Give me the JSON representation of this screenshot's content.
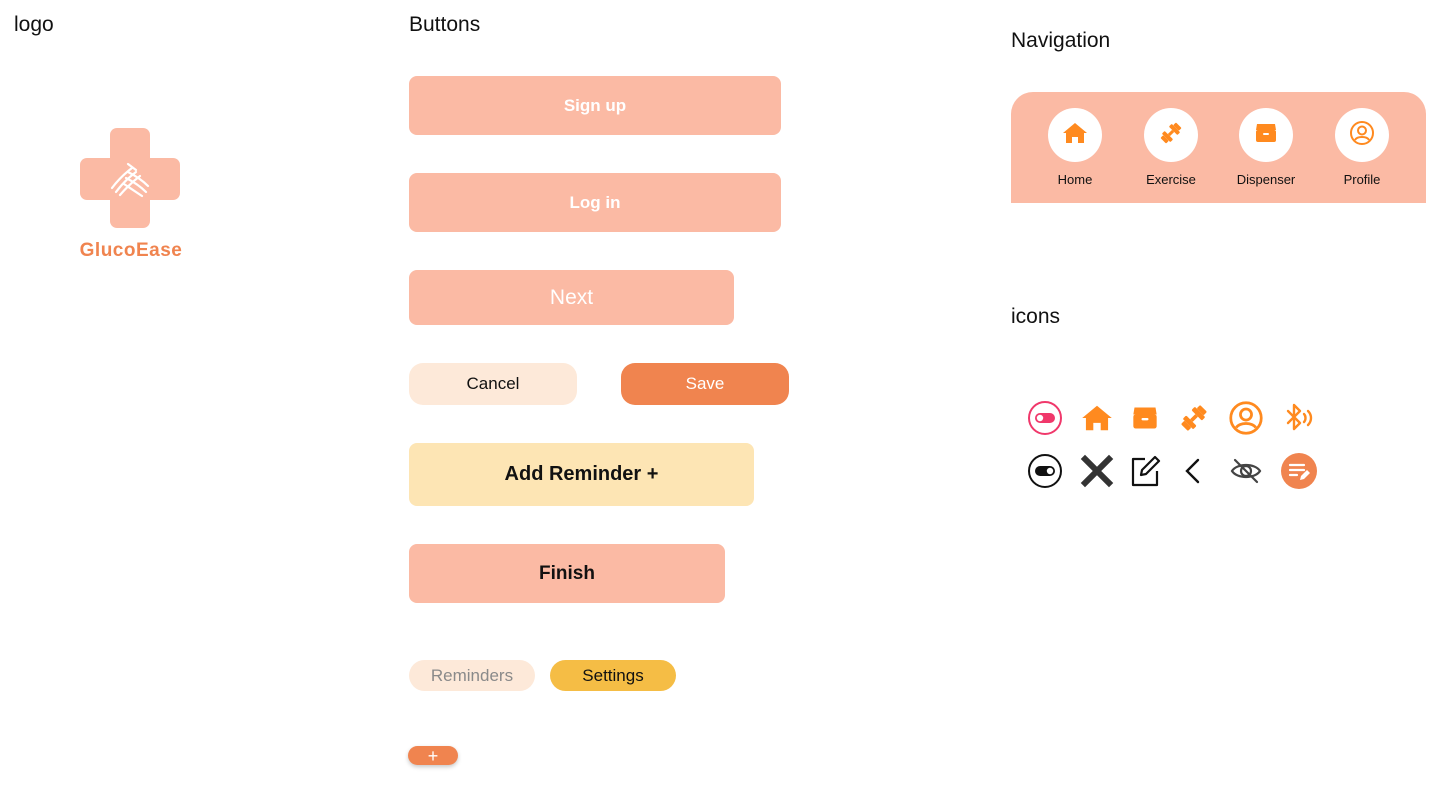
{
  "sections": {
    "logo": "logo",
    "buttons": "Buttons",
    "navigation": "Navigation",
    "icons": "icons"
  },
  "logo": {
    "name": "GlucoEase",
    "icon": "hands-cross-logo"
  },
  "buttons": {
    "signup": "Sign up",
    "login": "Log in",
    "next": "Next",
    "cancel": "Cancel",
    "save": "Save",
    "add_reminder": "Add Reminder +",
    "finish": "Finish",
    "reminders": "Reminders",
    "settings": "Settings",
    "plus": "+"
  },
  "navigation": {
    "items": [
      {
        "label": "Home",
        "icon": "home-icon"
      },
      {
        "label": "Exercise",
        "icon": "dumbbell-icon"
      },
      {
        "label": "Dispenser",
        "icon": "box-icon"
      },
      {
        "label": "Profile",
        "icon": "profile-icon"
      }
    ]
  },
  "icons": {
    "row1": [
      "toggle-off-icon",
      "home-icon",
      "box-icon",
      "dumbbell-icon",
      "profile-icon",
      "bluetooth-icon"
    ],
    "row2": [
      "toggle-on-icon",
      "close-icon",
      "edit-icon",
      "back-icon",
      "eye-off-icon",
      "note-edit-icon"
    ]
  },
  "colors": {
    "peach": "#fbbaa4",
    "accent_orange": "#f0844f",
    "icon_orange": "#ff8a1f",
    "cream": "#fde9d9",
    "yellow_light": "#fde5b4",
    "yellow": "#f5bd45"
  }
}
